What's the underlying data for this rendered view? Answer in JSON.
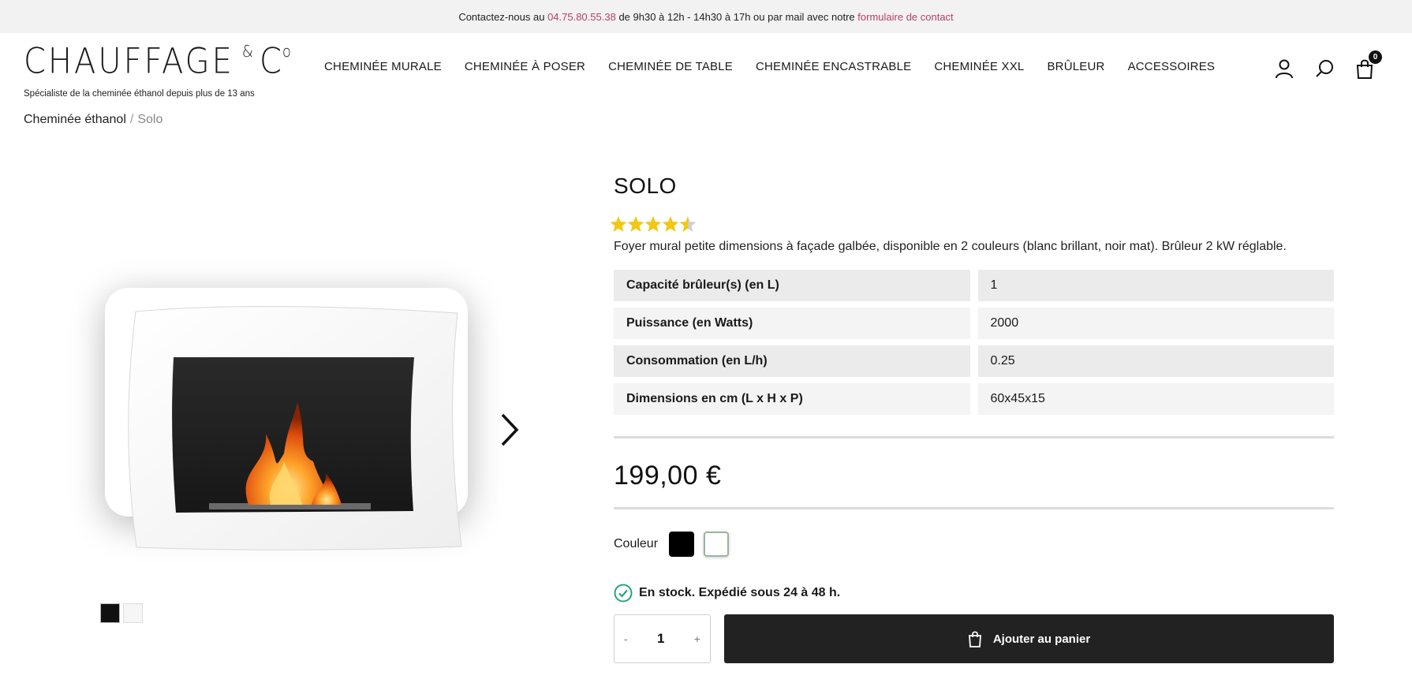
{
  "topbar": {
    "prefix": "Contactez-nous au",
    "phone": "04.75.80.55.38",
    "middle": "de 9h30 à 12h - 14h30 à 17h ou par mail avec notre",
    "contact_link": "formulaire de contact"
  },
  "logo": {
    "main": "CHAUFFAGE",
    "amp": "&",
    "co": "C",
    "co_sup": "o",
    "tagline": "Spécialiste de la cheminée éthanol depuis plus de 13 ans"
  },
  "nav": [
    "CHEMINÉE MURALE",
    "CHEMINÉE À POSER",
    "CHEMINÉE DE TABLE",
    "CHEMINÉE ENCASTRABLE",
    "CHEMINÉE XXL",
    "BRÛLEUR",
    "ACCESSOIRES"
  ],
  "header_icons": {
    "account": "user-icon",
    "search": "search-icon",
    "cart": "shopping-bag-icon",
    "cart_count": "0"
  },
  "breadcrumb": {
    "parent": "Cheminée éthanol",
    "separator": "/",
    "current": "Solo"
  },
  "product": {
    "title": "SOLO",
    "rating": 4.5,
    "rating_max": 5,
    "description": "Foyer mural petite dimensions à façade galbée, disponible en 2 couleurs (blanc brillant, noir mat). Brûleur 2 kW réglable.",
    "specs": [
      {
        "label": "Capacité brûleur(s) (en L)",
        "value": "1"
      },
      {
        "label": "Puissance (en Watts)",
        "value": "2000"
      },
      {
        "label": "Consommation (en L/h)",
        "value": "0.25"
      },
      {
        "label": "Dimensions en cm (L x H x P)",
        "value": "60x45x15"
      }
    ],
    "price": "199,00 €",
    "color_label": "Couleur",
    "colors": [
      {
        "name": "noir",
        "hex": "#000000"
      },
      {
        "name": "blanc",
        "hex": "#ffffff"
      }
    ],
    "stock_text": "En stock. Expédié sous 24 à 48 h.",
    "quantity": {
      "minus": "-",
      "value": "1",
      "plus": "+"
    },
    "add_to_cart": "Ajouter au panier"
  },
  "colors": {
    "accent_pink": "#b5406a",
    "stock_green": "#2aa57a",
    "star_yellow": "#f2c811",
    "button_dark": "#222222"
  }
}
